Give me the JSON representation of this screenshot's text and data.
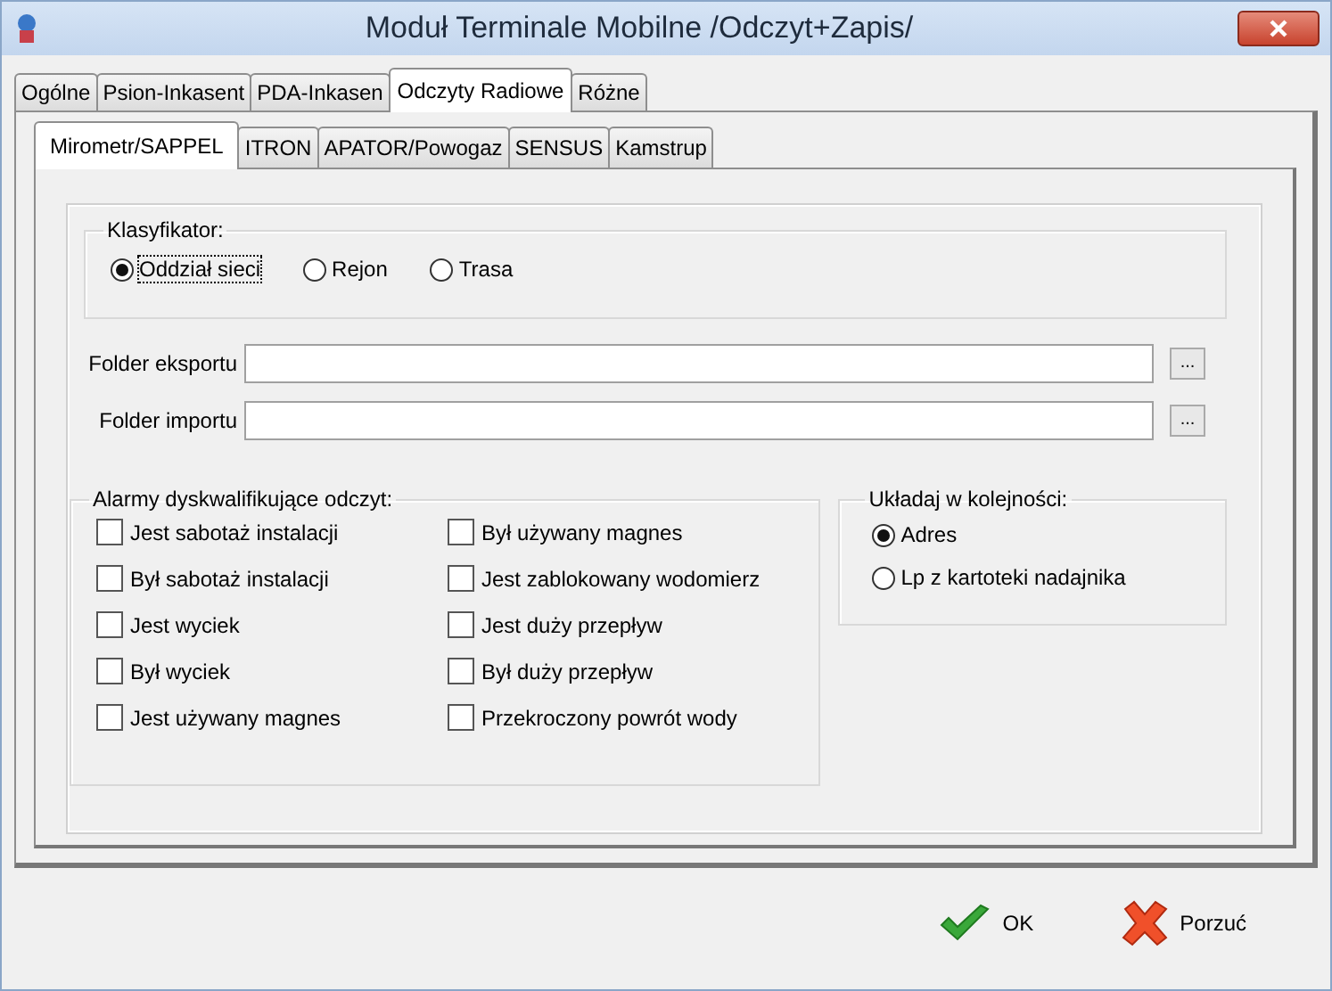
{
  "window": {
    "title": "Moduł Terminale Mobilne /Odczyt+Zapis/"
  },
  "tabs": [
    {
      "label": "Ogólne",
      "selected": false
    },
    {
      "label": "Psion-Inkasent",
      "selected": false
    },
    {
      "label": "PDA-Inkasen",
      "selected": false
    },
    {
      "label": "Odczyty Radiowe",
      "selected": true
    },
    {
      "label": "Różne",
      "selected": false
    }
  ],
  "subtabs": [
    {
      "label": "Mirometr/SAPPEL",
      "selected": true
    },
    {
      "label": "ITRON",
      "selected": false
    },
    {
      "label": "APATOR/Powogaz",
      "selected": false
    },
    {
      "label": "SENSUS",
      "selected": false
    },
    {
      "label": "Kamstrup",
      "selected": false
    }
  ],
  "classifier": {
    "title": "Klasyfikator:",
    "options": [
      {
        "label": "Oddział sieci",
        "selected": true
      },
      {
        "label": "Rejon",
        "selected": false
      },
      {
        "label": "Trasa",
        "selected": false
      }
    ]
  },
  "folders": [
    {
      "label": "Folder eksportu",
      "browse": "..."
    },
    {
      "label": "Folder importu",
      "browse": "..."
    }
  ],
  "alarms": {
    "title": "Alarmy dyskwalifikujące odczyt:",
    "columns": [
      [
        {
          "label": "Jest sabotaż instalacji",
          "checked": false
        },
        {
          "label": "Był sabotaż instalacji",
          "checked": false
        },
        {
          "label": "Jest wyciek",
          "checked": false
        },
        {
          "label": "Był wyciek",
          "checked": false
        },
        {
          "label": "Jest używany magnes",
          "checked": false
        }
      ],
      [
        {
          "label": "Był używany magnes",
          "checked": false
        },
        {
          "label": "Jest zablokowany wodomierz",
          "checked": false
        },
        {
          "label": "Jest duży przepływ",
          "checked": false
        },
        {
          "label": "Był duży przepływ",
          "checked": false
        },
        {
          "label": "Przekroczony powrót wody",
          "checked": false
        }
      ]
    ]
  },
  "order": {
    "title": "Układaj w kolejności:",
    "options": [
      {
        "label": "Adres",
        "selected": true
      },
      {
        "label": "Lp z kartoteki nadajnika",
        "selected": false
      }
    ]
  },
  "buttons": [
    {
      "kind": "ok",
      "label": "OK"
    },
    {
      "kind": "cancel",
      "label": "Porzuć"
    }
  ]
}
